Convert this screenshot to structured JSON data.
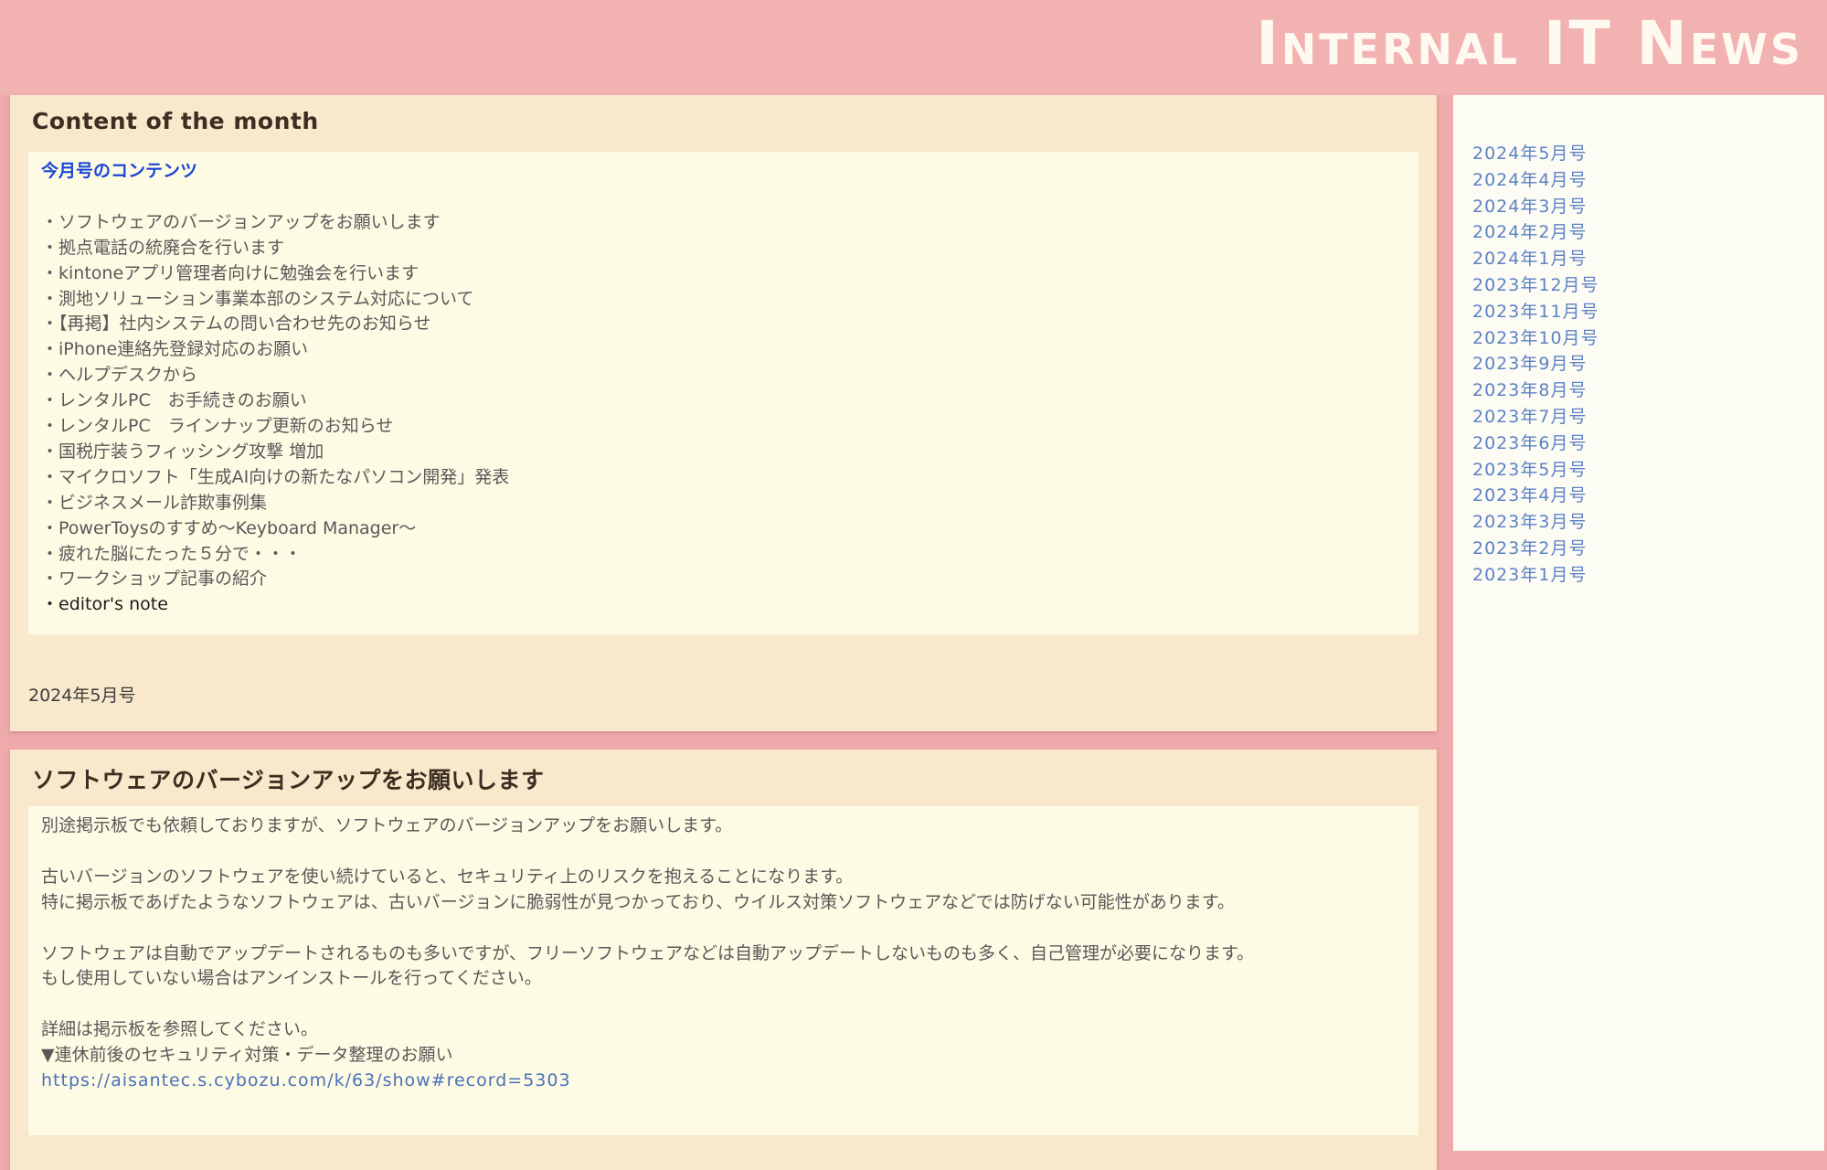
{
  "header": {
    "site_title": "Internal IT News"
  },
  "card1": {
    "heading": "Content of the month",
    "subtitle": "今月号のコンテンツ",
    "items": [
      "・ソフトウェアのバージョンアップをお願いします",
      "・拠点電話の統廃合を行います",
      "・kintoneアプリ管理者向けに勉強会を行います",
      "・測地ソリューション事業本部のシステム対応について",
      "・【再掲】社内システムの問い合わせ先のお知らせ",
      "・iPhone連絡先登録対応のお願い",
      "・ヘルプデスクから",
      "・レンタルPC　お手続きのお願い",
      "・レンタルPC　ラインナップ更新のお知らせ",
      "・国税庁装うフィッシング攻撃 増加",
      "・マイクロソフト「生成AI向けの新たなパソコン開発」発表",
      "・ビジネスメール詐欺事例集",
      "・PowerToysのすすめ～Keyboard Manager～",
      "・疲れた脳にたった５分で・・・",
      "・ワークショップ記事の紹介",
      "・editor's note"
    ],
    "issue": "2024年5月号"
  },
  "card2": {
    "heading": "ソフトウェアのバージョンアップをお願いします",
    "p1": "別途掲示板でも依頼しておりますが、ソフトウェアのバージョンアップをお願いします。",
    "p2a": "古いバージョンのソフトウェアを使い続けていると、セキュリティ上のリスクを抱えることになります。",
    "p2b": "特に掲示板であげたようなソフトウェアは、古いバージョンに脆弱性が見つかっており、ウイルス対策ソフトウェアなどでは防げない可能性があります。",
    "p3a": "ソフトウェアは自動でアップデートされるものも多いですが、フリーソフトウェアなどは自動アップデートしないものも多く、自己管理が必要になります。",
    "p3b": "もし使用していない場合はアンインストールを行ってください。",
    "p4a": "詳細は掲示板を参照してください。",
    "p4b": "▼連休前後のセキュリティ対策・データ整理のお願い",
    "link": "https://aisantec.s.cybozu.com/k/63/show#record=5303"
  },
  "sidebar": {
    "archives": [
      "2024年5月号",
      "2024年4月号",
      "2024年3月号",
      "2024年2月号",
      "2024年1月号",
      "2023年12月号",
      "2023年11月号",
      "2023年10月号",
      "2023年9月号",
      "2023年8月号",
      "2023年7月号",
      "2023年6月号",
      "2023年5月号",
      "2023年4月号",
      "2023年3月号",
      "2023年2月号",
      "2023年1月号"
    ]
  },
  "colors": {
    "page_background": "#efaaab",
    "header_background": "#f2b2b2",
    "card_background": "#f9e8cb",
    "panel_background": "#fefbe4",
    "sidebar_background": "#fcfcf5",
    "subtitle_blue": "#1a46d6",
    "link_blue": "#5d82c4"
  }
}
